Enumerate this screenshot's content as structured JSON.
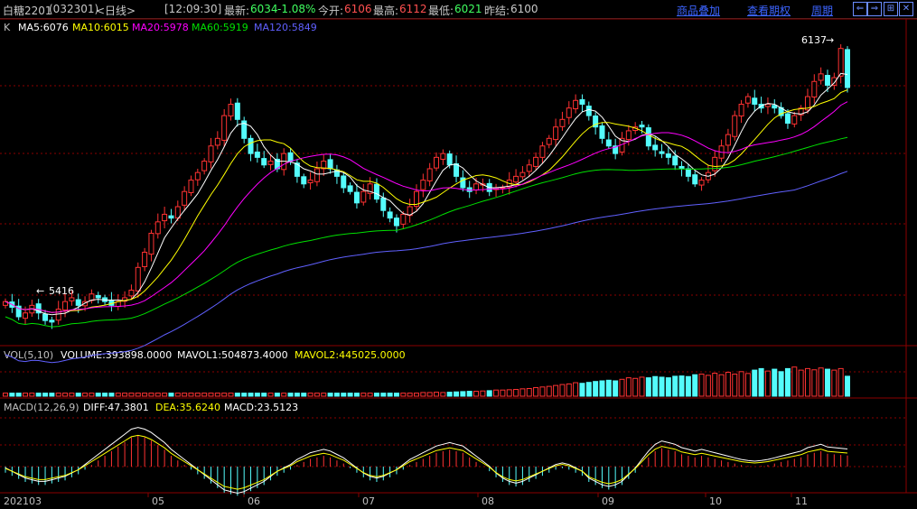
{
  "header": {
    "title": "白糖2201",
    "code": "(032301)",
    "period": "<日线>",
    "time": "[12:09:30]",
    "latest_label": "最新:",
    "latest": "6034",
    "change": "-1.08%",
    "open_label": "今开:",
    "open": "6106",
    "high_label": "最高:",
    "high": "6112",
    "low_label": "最低:",
    "low": "6021",
    "prev_label": "昨结:",
    "prev": "6100",
    "links": [
      "商品叠加",
      "查看期权",
      "周期"
    ],
    "buttons": [
      "⇐",
      "⇒",
      "⊞",
      "✕"
    ]
  },
  "main_legend": {
    "k": "K",
    "ma5": "MA5:6076",
    "ma10": "MA10:6015",
    "ma20": "MA20:5978",
    "ma60": "MA60:5919",
    "ma120": "MA120:5849",
    "high_mark": "6137",
    "low_mark": "5416"
  },
  "vol_legend": {
    "name": "VOL(5,10)",
    "volume": "VOLUME:393898.0000",
    "mavol1": "MAVOL1:504873.4000",
    "mavol2": "MAVOL2:445025.0000"
  },
  "macd_legend": {
    "name": "MACD(12,26,9)",
    "diff": "DIFF:47.3801",
    "dea": "DEA:35.6240",
    "macd": "MACD:23.5123"
  },
  "x_axis": [
    "202103",
    "05",
    "06",
    "07",
    "08",
    "09",
    "10",
    "11"
  ],
  "colors": {
    "up": "#ff3232",
    "down": "#54fcfc",
    "ma5": "#ffffff",
    "ma10": "#ffff00",
    "ma20": "#ff00ff",
    "ma60": "#00e000",
    "ma120": "#6060ff",
    "grid": "#8b0000"
  },
  "chart_data": {
    "type": "candlestick",
    "price_range": [
      5380,
      6160
    ],
    "price_series": [
      5470,
      5455,
      5430,
      5440,
      5460,
      5440,
      5420,
      5416,
      5450,
      5470,
      5480,
      5460,
      5470,
      5490,
      5480,
      5470,
      5460,
      5470,
      5480,
      5500,
      5560,
      5600,
      5650,
      5680,
      5700,
      5690,
      5720,
      5760,
      5790,
      5810,
      5840,
      5880,
      5900,
      5960,
      5990,
      5950,
      5900,
      5860,
      5850,
      5830,
      5840,
      5820,
      5860,
      5840,
      5800,
      5780,
      5790,
      5820,
      5840,
      5820,
      5800,
      5770,
      5760,
      5730,
      5760,
      5780,
      5740,
      5710,
      5690,
      5670,
      5700,
      5720,
      5760,
      5790,
      5820,
      5850,
      5860,
      5830,
      5800,
      5770,
      5760,
      5780,
      5780,
      5760,
      5770,
      5770,
      5790,
      5800,
      5810,
      5830,
      5850,
      5880,
      5900,
      5930,
      5950,
      5980,
      6000,
      5990,
      5960,
      5930,
      5900,
      5880,
      5860,
      5900,
      5920,
      5930,
      5930,
      5880,
      5870,
      5860,
      5850,
      5830,
      5820,
      5800,
      5780,
      5790,
      5810,
      5850,
      5880,
      5910,
      5960,
      5990,
      6010,
      5990,
      5980,
      5990,
      5980,
      5960,
      5940,
      5960,
      5980,
      6010,
      6050,
      6070,
      6040,
      6060,
      6137,
      6034
    ],
    "volume_series": [
      0.1,
      0.1,
      0.1,
      0.1,
      0.1,
      0.1,
      0.1,
      0.1,
      0.1,
      0.1,
      0.1,
      0.1,
      0.1,
      0.1,
      0.1,
      0.1,
      0.1,
      0.1,
      0.1,
      0.1,
      0.1,
      0.1,
      0.1,
      0.1,
      0.1,
      0.1,
      0.1,
      0.1,
      0.1,
      0.1,
      0.1,
      0.1,
      0.1,
      0.1,
      0.1,
      0.1,
      0.1,
      0.1,
      0.1,
      0.1,
      0.1,
      0.1,
      0.1,
      0.1,
      0.1,
      0.1,
      0.1,
      0.1,
      0.1,
      0.1,
      0.1,
      0.1,
      0.1,
      0.1,
      0.1,
      0.1,
      0.1,
      0.1,
      0.1,
      0.1,
      0.1,
      0.1,
      0.1,
      0.12,
      0.12,
      0.13,
      0.12,
      0.13,
      0.14,
      0.15,
      0.16,
      0.16,
      0.17,
      0.18,
      0.2,
      0.2,
      0.21,
      0.22,
      0.24,
      0.25,
      0.28,
      0.3,
      0.32,
      0.35,
      0.38,
      0.4,
      0.44,
      0.42,
      0.45,
      0.48,
      0.5,
      0.52,
      0.5,
      0.55,
      0.6,
      0.58,
      0.62,
      0.6,
      0.64,
      0.62,
      0.6,
      0.65,
      0.66,
      0.64,
      0.7,
      0.72,
      0.68,
      0.75,
      0.7,
      0.78,
      0.72,
      0.8,
      0.74,
      0.85,
      0.9,
      0.82,
      0.88,
      0.8,
      0.9,
      0.95,
      0.85,
      0.9,
      0.86,
      0.92,
      0.88,
      0.85,
      0.9,
      0.65
    ],
    "macd_series": [
      -0.2,
      -0.3,
      -0.4,
      -0.5,
      -0.55,
      -0.6,
      -0.6,
      -0.55,
      -0.5,
      -0.45,
      -0.35,
      -0.25,
      -0.1,
      0.05,
      0.2,
      0.35,
      0.5,
      0.65,
      0.8,
      0.95,
      1.0,
      0.95,
      0.85,
      0.7,
      0.55,
      0.35,
      0.2,
      0.05,
      -0.1,
      -0.25,
      -0.4,
      -0.55,
      -0.7,
      -0.85,
      -0.9,
      -0.95,
      -0.9,
      -0.8,
      -0.7,
      -0.6,
      -0.45,
      -0.3,
      -0.2,
      -0.1,
      0.05,
      0.15,
      0.25,
      0.3,
      0.35,
      0.3,
      0.2,
      0.1,
      -0.05,
      -0.2,
      -0.35,
      -0.45,
      -0.5,
      -0.45,
      -0.35,
      -0.25,
      -0.1,
      0.05,
      0.15,
      0.25,
      0.35,
      0.45,
      0.5,
      0.55,
      0.5,
      0.45,
      0.3,
      0.15,
      0.0,
      -0.15,
      -0.35,
      -0.5,
      -0.6,
      -0.65,
      -0.6,
      -0.5,
      -0.4,
      -0.3,
      -0.2,
      -0.1,
      -0.05,
      -0.1,
      -0.2,
      -0.3,
      -0.5,
      -0.6,
      -0.7,
      -0.75,
      -0.7,
      -0.6,
      -0.4,
      -0.2,
      0.05,
      0.3,
      0.5,
      0.6,
      0.55,
      0.5,
      0.4,
      0.35,
      0.3,
      0.35,
      0.3,
      0.25,
      0.2,
      0.15,
      0.1,
      0.05,
      0.02,
      0.0,
      0.02,
      0.05,
      0.1,
      0.15,
      0.2,
      0.25,
      0.3,
      0.4,
      0.45,
      0.5,
      0.42,
      0.4,
      0.38,
      0.36
    ]
  }
}
